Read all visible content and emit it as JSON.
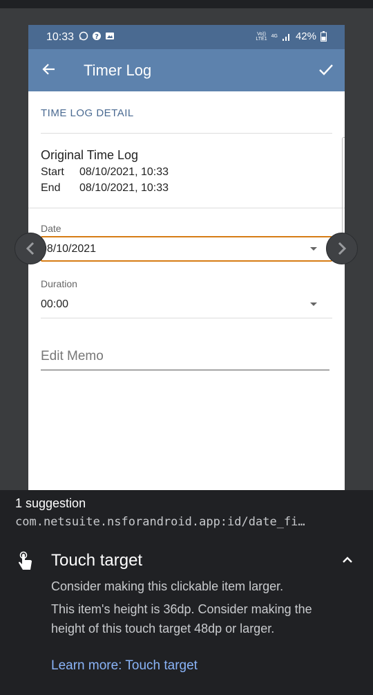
{
  "status_bar": {
    "time": "10:33",
    "network_top": "Vo))",
    "network_bottom": "LTE1",
    "network_gen": "4G",
    "battery": "42%"
  },
  "app_bar": {
    "title": "Timer Log"
  },
  "detail": {
    "section_title": "TIME LOG DETAIL",
    "original_title": "Original Time Log",
    "start_label": "Start",
    "start_value": "08/10/2021, 10:33",
    "end_label": "End",
    "end_value": "08/10/2021, 10:33",
    "date_label": "Date",
    "date_value": "08/10/2021",
    "duration_label": "Duration",
    "duration_value": "00:00",
    "memo_placeholder": "Edit Memo"
  },
  "suggestions": {
    "count": "1 suggestion",
    "element_id": "com.netsuite.nsforandroid.app:id/date_fi…",
    "check_title": "Touch target",
    "description_1": "Consider making this clickable item larger.",
    "description_2": "This item's height is 36dp. Consider making the height of this touch target 48dp or larger.",
    "learn_more": "Learn more: Touch target"
  },
  "colors": {
    "status_bar": "#4a6a91",
    "app_bar": "#5d82ad",
    "highlight": "#d67c14",
    "panel": "#202124",
    "link": "#8ab4f8"
  }
}
